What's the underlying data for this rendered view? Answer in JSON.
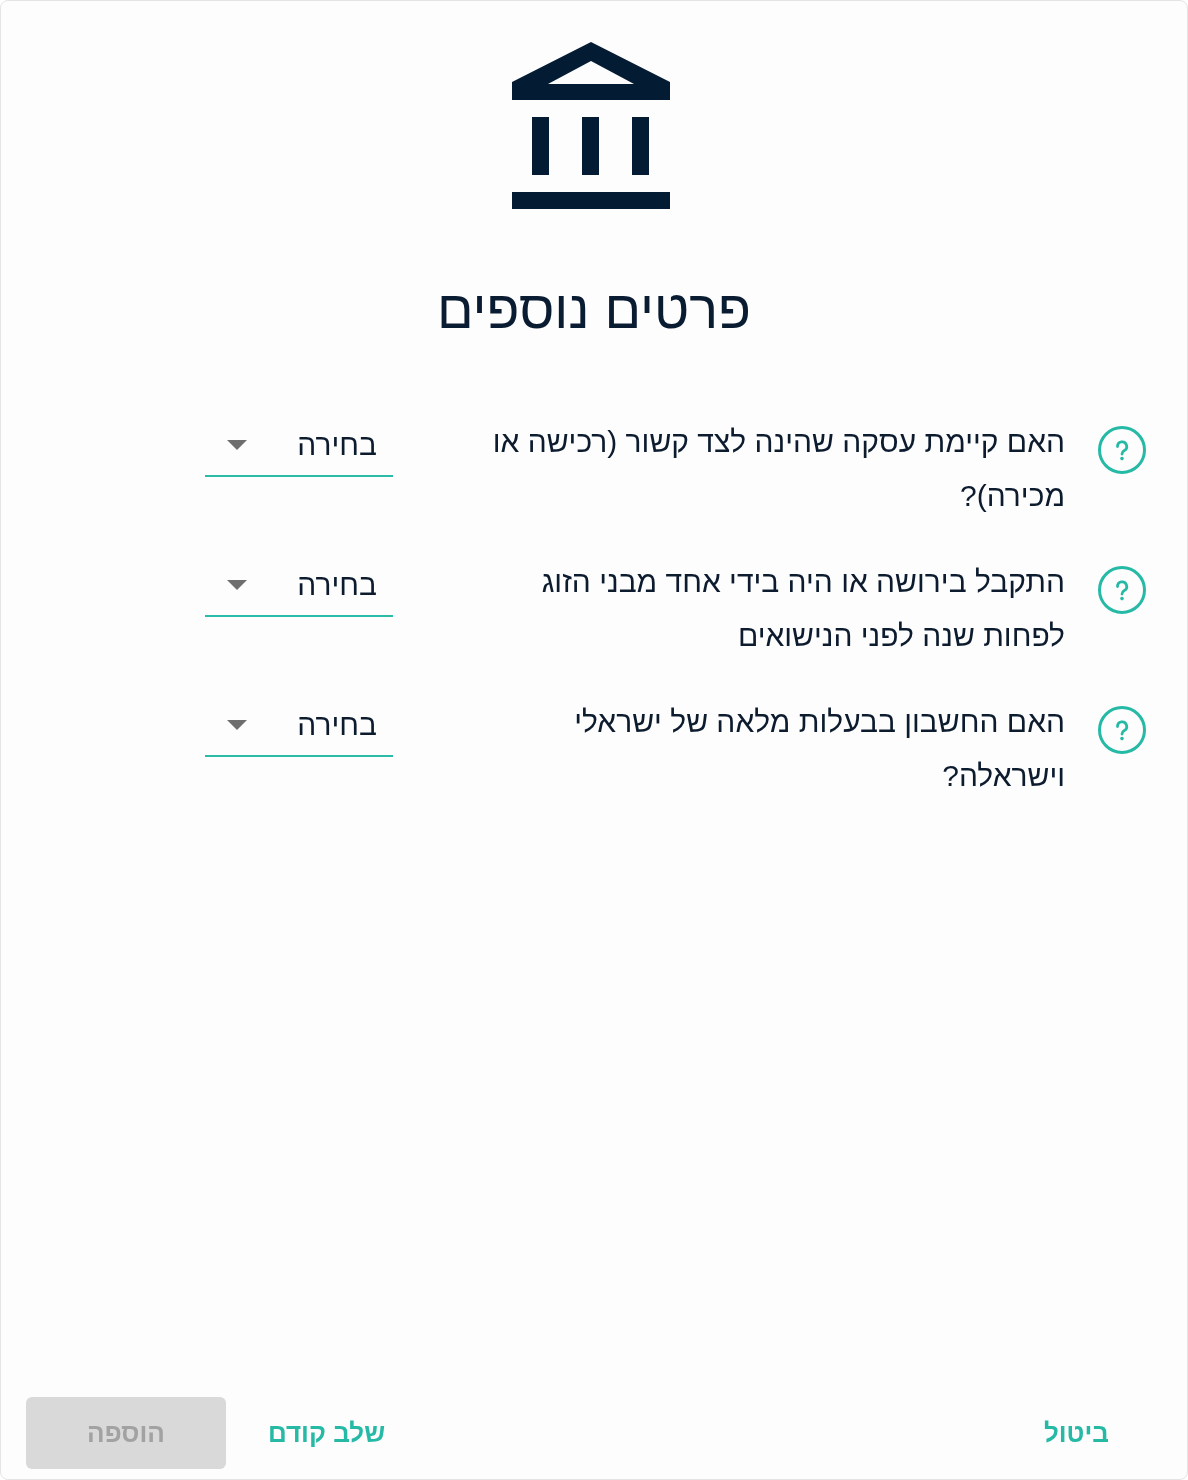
{
  "header": {
    "title": "פרטים נוספים"
  },
  "questions": [
    {
      "text": "האם קיימת עסקה שהינה לצד קשור (רכישה או מכירה)?",
      "select": {
        "value": "בחירה"
      }
    },
    {
      "text": "התקבל בירושה או היה בידי אחד מבני הזוג לפחות שנה לפני הנישואים",
      "select": {
        "value": "בחירה"
      }
    },
    {
      "text": "האם החשבון בבעלות מלאה של ישראלי וישראלה?",
      "select": {
        "value": "בחירה"
      }
    }
  ],
  "footer": {
    "cancel_button": {
      "label": "ביטול",
      "disabled": false
    },
    "buttons": [
      {
        "kind": "text",
        "label": "שלב קודם",
        "disabled": false
      },
      {
        "kind": "filled",
        "label": "הוספה",
        "disabled": true
      }
    ]
  }
}
